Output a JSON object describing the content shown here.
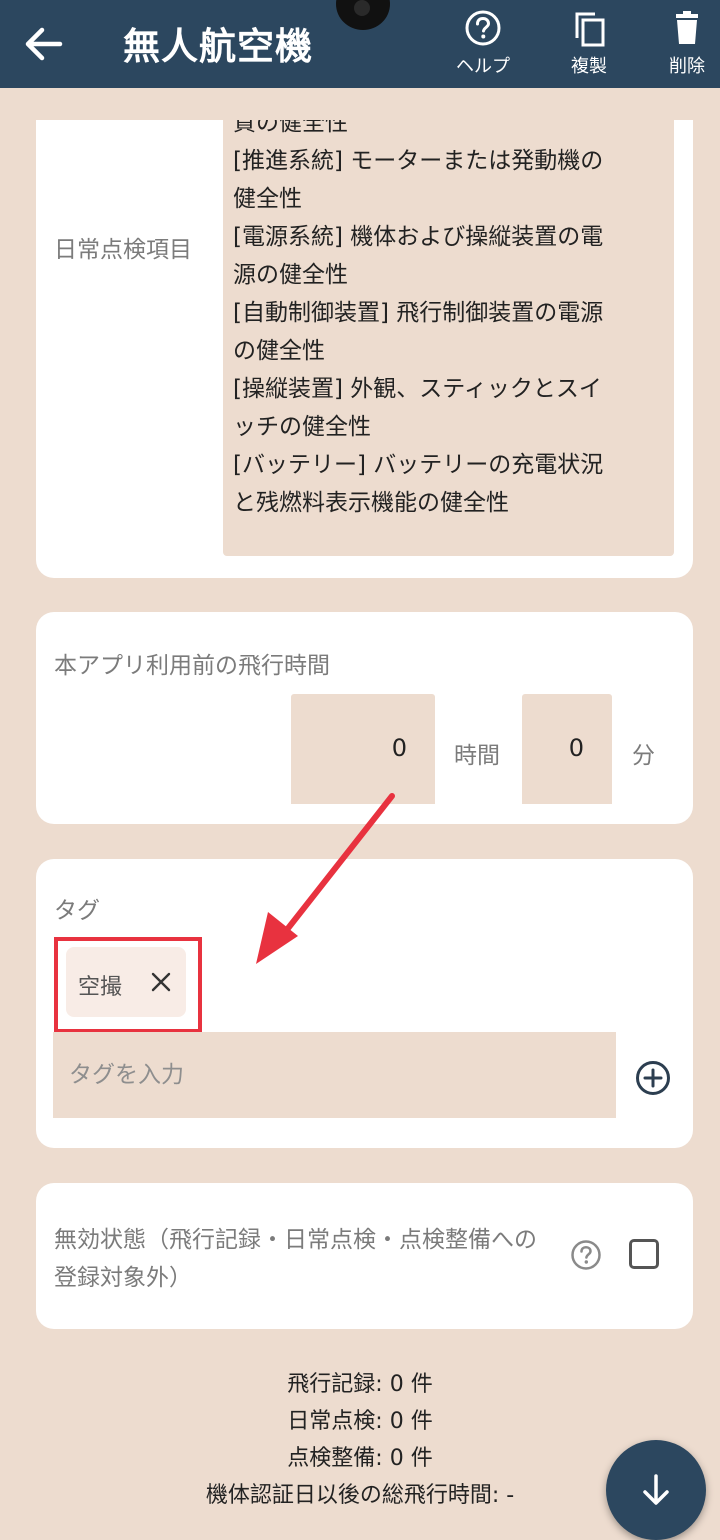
{
  "appbar": {
    "title": "無人航空機",
    "help_label": "ヘルプ",
    "duplicate_label": "複製",
    "delete_label": "削除"
  },
  "inspection": {
    "label": "日常点検項目",
    "lines": [
      "質の健全性",
      "[推進系統] モーターまたは発動機の",
      "健全性",
      "[電源系統] 機体および操縦装置の電",
      "源の健全性",
      "[自動制御装置] 飛行制御装置の電源",
      "の健全性",
      "[操縦装置] 外観、スティックとスイ",
      "ッチの健全性",
      "[バッテリー] バッテリーの充電状況",
      "と残燃料表示機能の健全性"
    ]
  },
  "prior_flight_time": {
    "label": "本アプリ利用前の飛行時間",
    "hours_value": "0",
    "hours_unit": "時間",
    "minutes_value": "0",
    "minutes_unit": "分"
  },
  "tags": {
    "label": "タグ",
    "chip_label": "空撮",
    "input_placeholder": "タグを入力"
  },
  "disabled_state": {
    "label": "無効状態（飛行記録・日常点検・点検整備への登録対象外）"
  },
  "summary": {
    "flight_records": "飛行記録: 0 件",
    "daily_inspections": "日常点検: 0 件",
    "maintenance": "点検整備: 0 件",
    "total_flight_time": "機体認証日以後の総飛行時間: -"
  },
  "colors": {
    "appbar": "#2c475f",
    "background": "#eddccf",
    "highlight": "#e8323f"
  }
}
